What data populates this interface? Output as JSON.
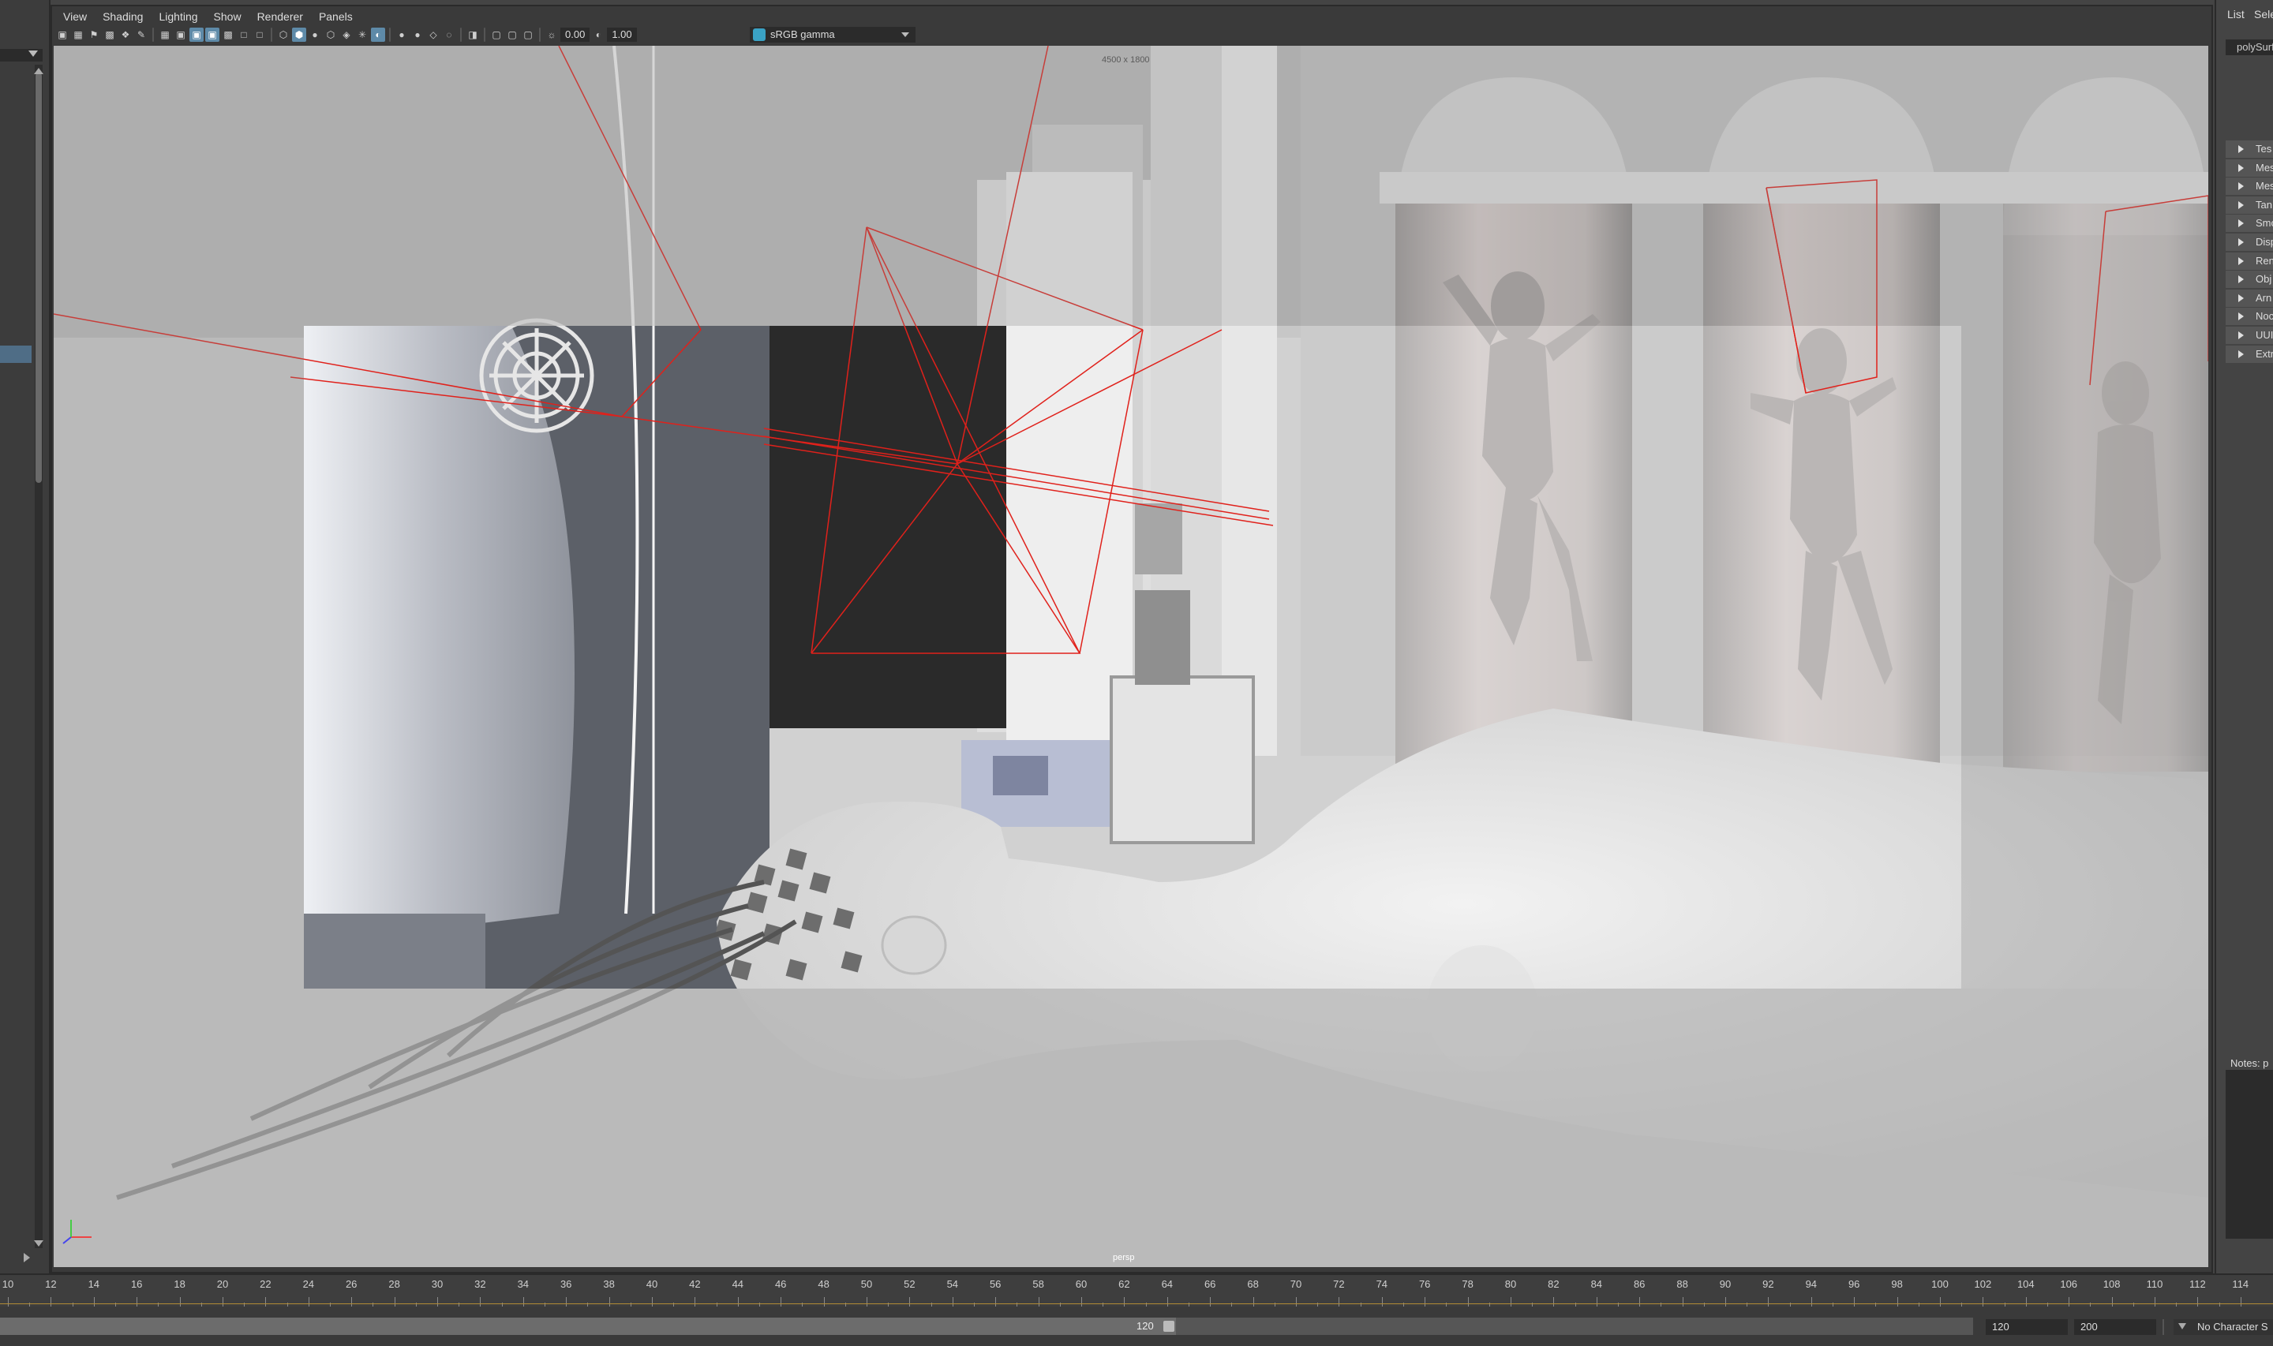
{
  "menubar": {
    "items": [
      "View",
      "Shading",
      "Lighting",
      "Show",
      "Renderer",
      "Panels"
    ]
  },
  "toolbar": {
    "exposure": "0.00",
    "gamma_value": "1.00",
    "color_space": "sRGB gamma"
  },
  "viewport": {
    "resolution_label": "4500 x 1800",
    "camera_label": "persp"
  },
  "right_panel": {
    "tabs": [
      "List",
      "Sele"
    ],
    "object_name": "polySurf",
    "sections": [
      "Tes",
      "Mes",
      "Mes",
      "Tan",
      "Smo",
      "Disp",
      "Ren",
      "Obj",
      "Arn",
      "Noc",
      "UUI",
      "Extr"
    ],
    "notes_label": "Notes: p"
  },
  "timeline": {
    "ticks": [
      "10",
      "12",
      "14",
      "16",
      "18",
      "20",
      "22",
      "24",
      "26",
      "28",
      "30",
      "32",
      "34",
      "36",
      "38",
      "40",
      "42",
      "44",
      "46",
      "48",
      "50",
      "52",
      "54",
      "56",
      "58",
      "60",
      "62",
      "64",
      "66",
      "68",
      "70",
      "72",
      "74",
      "76",
      "78",
      "80",
      "82",
      "84",
      "86",
      "88",
      "90",
      "92",
      "94",
      "96",
      "98",
      "100",
      "102",
      "104",
      "106",
      "108",
      "110",
      "112",
      "114"
    ]
  },
  "range": {
    "slider_end": "120",
    "start_field": "120",
    "end_field": "200",
    "character_set": "No Character S"
  },
  "colors": {
    "accent": "#5e8aa8",
    "viewport_bg": "#c9c9c9",
    "ui_bg": "#444444",
    "camera_frustum": "#e0211b",
    "timeline_marker": "#b28b34"
  }
}
